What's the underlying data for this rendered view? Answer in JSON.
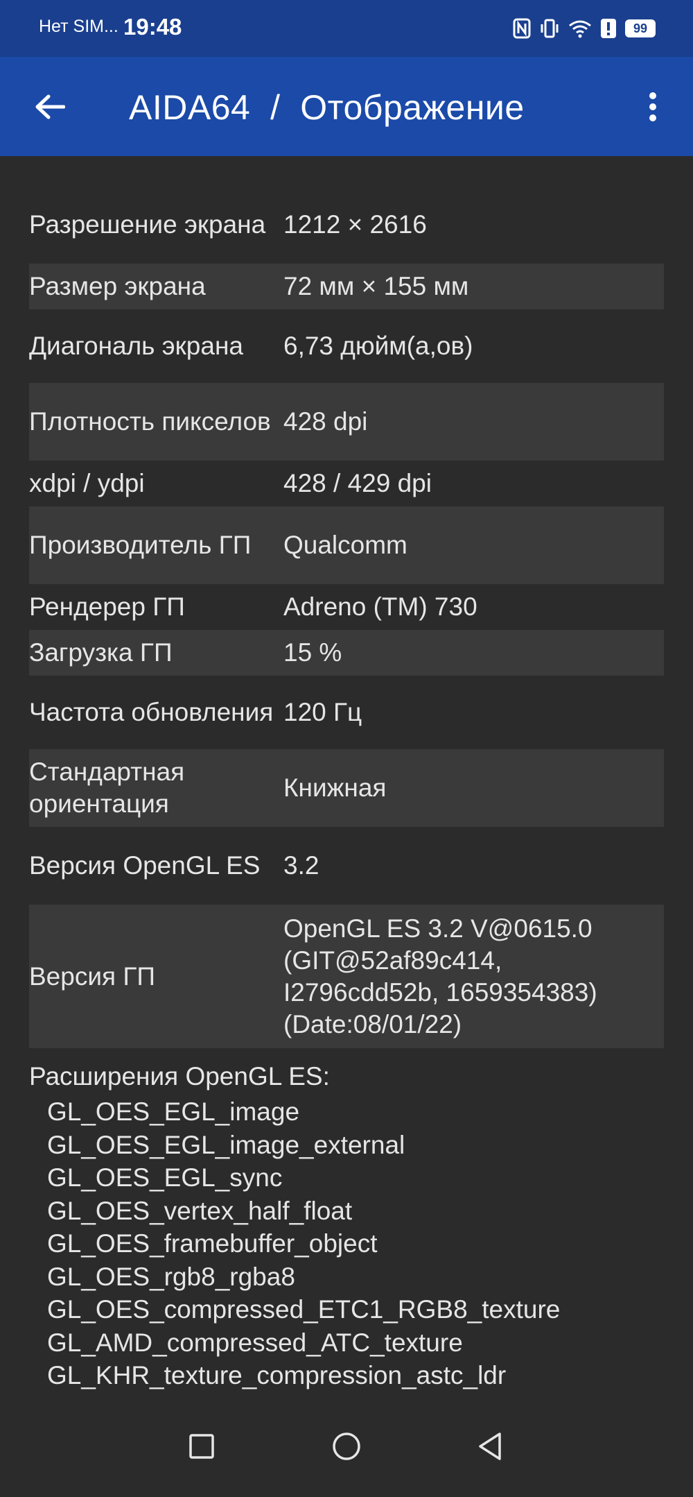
{
  "status_bar": {
    "carrier": "Нет SIM...",
    "time": "19:48",
    "battery": "99",
    "icons": [
      "nfc-icon",
      "vibrate-icon",
      "wifi-icon",
      "alert-icon",
      "battery-icon"
    ]
  },
  "app_bar": {
    "title": "AIDA64  /  Отображение",
    "back_icon": "arrow-left-icon",
    "menu_icon": "more-vertical-icon"
  },
  "rows": [
    {
      "label": "Разрешение экрана",
      "value": "1212 × 2616"
    },
    {
      "label": "Размер экрана",
      "value": "72 мм × 155 мм"
    },
    {
      "label": "Диагональ экрана",
      "value": "6,73 дюйм(а,ов)"
    },
    {
      "label": "Плотность пикселов",
      "value": "428 dpi"
    },
    {
      "label": "xdpi / ydpi",
      "value": "428 / 429 dpi"
    },
    {
      "label": "Производитель ГП",
      "value": "Qualcomm"
    },
    {
      "label": "Рендерер ГП",
      "value": "Adreno (TM) 730"
    },
    {
      "label": "Загрузка ГП",
      "value": "15 %"
    },
    {
      "label": "Частота обновления",
      "value": "120 Гц"
    },
    {
      "label": "Стандартная ориентация",
      "value": "Книжная"
    },
    {
      "label": "Версия OpenGL ES",
      "value": "3.2"
    },
    {
      "label": "Версия ГП",
      "value": "OpenGL ES 3.2 V@0615.0 (GIT@52af89c414, I2796cdd52b, 1659354383) (Date:08/01/22)"
    }
  ],
  "extensions": {
    "title": "Расширения OpenGL ES:",
    "items": [
      "GL_OES_EGL_image",
      "GL_OES_EGL_image_external",
      "GL_OES_EGL_sync",
      "GL_OES_vertex_half_float",
      "GL_OES_framebuffer_object",
      "GL_OES_rgb8_rgba8",
      "GL_OES_compressed_ETC1_RGB8_texture",
      "GL_AMD_compressed_ATC_texture",
      "GL_KHR_texture_compression_astc_ldr"
    ]
  },
  "nav_bar": {
    "icons": [
      "app-logo-icon",
      "recents-square-icon",
      "home-circle-icon",
      "back-triangle-icon"
    ]
  }
}
